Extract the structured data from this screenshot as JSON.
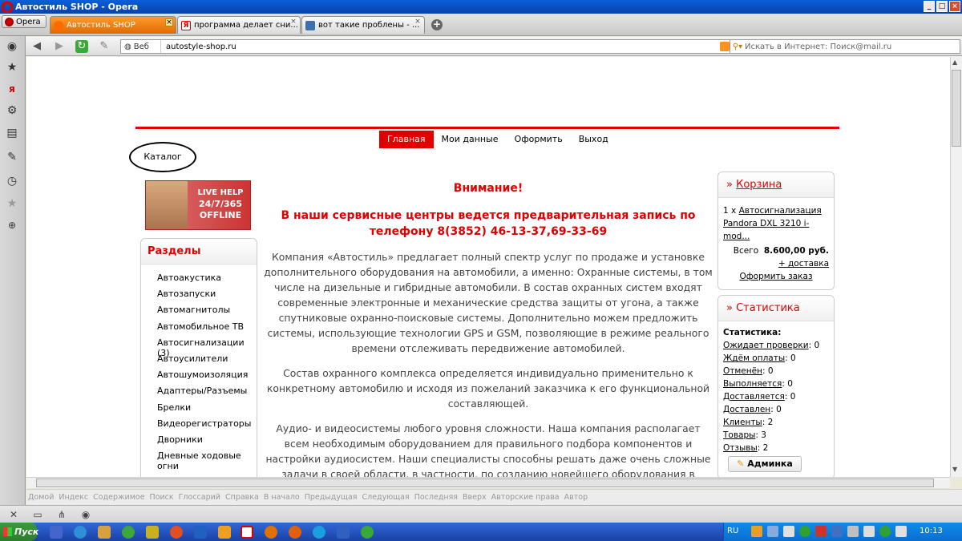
{
  "window": {
    "title": "Автостиль SHOP - Opera"
  },
  "browser": {
    "menu_label": "Opera",
    "tabs": [
      {
        "label": "Автостиль SHOP",
        "active": true
      },
      {
        "label": "программа делает сни...",
        "active": false
      },
      {
        "label": "вот такие проблены - ...",
        "active": false
      }
    ],
    "address": {
      "web_label": "Веб",
      "url": "autostyle-shop.ru"
    },
    "search": {
      "placeholder": "Искать в Интернет: Поиск@mail.ru"
    }
  },
  "site": {
    "nav": [
      {
        "label": "Главная",
        "active": true
      },
      {
        "label": "Мои данные",
        "active": false
      },
      {
        "label": "Оформить",
        "active": false
      },
      {
        "label": "Выход",
        "active": false
      }
    ],
    "catalog_label": "Каталог",
    "livehelp": {
      "line1": "LIVE HELP",
      "line2": "24/7/365",
      "line3": "OFFLINE"
    },
    "sections": {
      "title": "Разделы",
      "items": [
        "Автоакустика",
        "Автозапуски",
        "Автомагнитолы",
        "Автомобильное ТВ",
        "Автосигнализации (3)",
        "Автоусилители",
        "Автошумоизоляция",
        "Адаптеры/Разъемы",
        "Брелки",
        "Видеорегистраторы",
        "Дворники",
        "Дневные ходовые огни"
      ]
    },
    "content": {
      "warning": "Внимание!",
      "notice": "В наши сервисные центры ведется предварительная запись по телефону 8(3852) 46-13-37,69-33-69",
      "paragraphs": [
        "Компания «Автостиль» предлагает полный спектр услуг по продаже и установке дополнительного оборудования на автомобили, а именно: Охранные системы, в том числе на дизельные и гибридные автомобили. В состав охранных систем входят современные электронные и механические средства защиты от угона, а также спутниковые охранно-поисковые системы. Дополнительно можем предложить системы, использующие технологии GPS и GSM, позволяющие в режиме реального времени отслеживать передвижение автомобилей.",
        "Состав охранного комплекса определяется индивидуально применительно к конкретному автомобилю и исходя из пожеланий заказчика к его функциональной составляющей.",
        "Аудио- и видеосистемы любого уровня сложности. Наша компания располагает всем необходимым оборудованием для правильного подбора компонентов и настройки аудиосистем. Наши специалисты способны решать даже очень сложные задачи в своей области, в частности, по созданию новейшего оборудования в"
      ]
    },
    "cart": {
      "title_prefix": "»",
      "title": "Корзина",
      "qty": "1 x",
      "item": "Автосигнализация Pandora DXL 3210 i-mod...",
      "total_label": "Всего",
      "total_value": "8.600,00 руб.",
      "shipping": "+ доставка",
      "checkout": "Оформить заказ"
    },
    "stats": {
      "title_prefix": "»",
      "title": "Статистика",
      "heading": "Статистика:",
      "rows": [
        {
          "label": "Ожидает проверки",
          "value": ": 0"
        },
        {
          "label": "Ждём оплаты",
          "value": ": 0"
        },
        {
          "label": "Отменён",
          "value": ": 0"
        },
        {
          "label": "Выполняется",
          "value": ": 0"
        },
        {
          "label": "Доставляется",
          "value": ": 0"
        },
        {
          "label": "Доставлен",
          "value": ": 0"
        },
        {
          "label": "Клиенты",
          "value": ": 2"
        },
        {
          "label": "Товары",
          "value": ": 3"
        },
        {
          "label": "Отзывы",
          "value": ": 2"
        }
      ],
      "admin_label": "Админка"
    }
  },
  "navbar": [
    "Домой",
    "Индекс",
    "Содержимое",
    "Поиск",
    "Глоссарий",
    "Справка",
    "В начало",
    "Предыдущая",
    "Следующая",
    "Последняя",
    "Вверх",
    "Авторские права",
    "Автор"
  ],
  "taskbar": {
    "start_label": "Пуск",
    "lang": "RU",
    "clock": "10:13"
  },
  "colors": {
    "accent_red": "#e00000",
    "tab_active": "#ff9a2e",
    "taskbar_blue": "#3168d5"
  }
}
